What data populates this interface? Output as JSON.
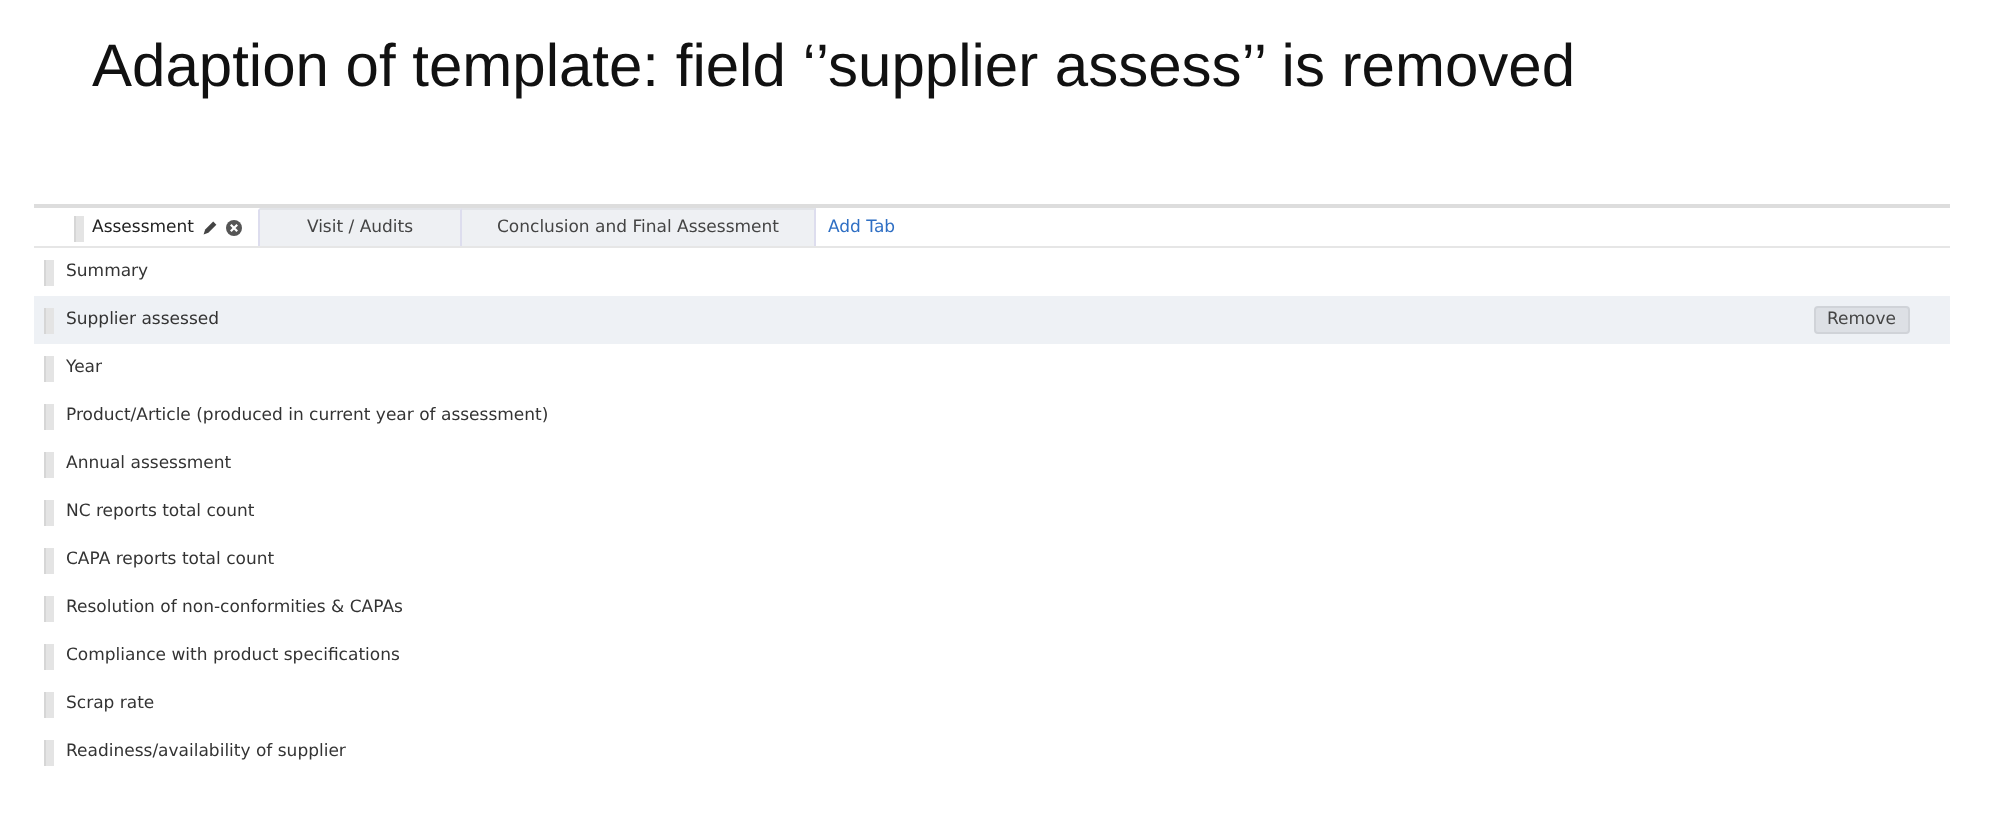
{
  "slide_title": "Adaption of template: field ‘’supplier assess’’ is removed",
  "tabs": [
    {
      "label": "Assessment",
      "kind": "tab",
      "selected": true
    },
    {
      "label": "Visit / Audits",
      "kind": "tab",
      "selected": false
    },
    {
      "label": "Conclusion and Final Assessment",
      "kind": "tab",
      "selected": false
    },
    {
      "label": "Add Tab",
      "kind": "link"
    }
  ],
  "fields": [
    {
      "label": "Summary",
      "hovered": false
    },
    {
      "label": "Supplier assessed",
      "hovered": true,
      "action": "Remove"
    },
    {
      "label": "Year",
      "hovered": false
    },
    {
      "label": "Product/Article (produced in current year of assessment)",
      "hovered": false
    },
    {
      "label": "Annual assessment",
      "hovered": false
    },
    {
      "label": "NC reports total count",
      "hovered": false
    },
    {
      "label": "CAPA reports total count",
      "hovered": false
    },
    {
      "label": "Resolution of non-conformities & CAPAs",
      "hovered": false
    },
    {
      "label": "Compliance with product specifications",
      "hovered": false
    },
    {
      "label": "Scrap rate",
      "hovered": false
    },
    {
      "label": "Readiness/availability of supplier",
      "hovered": false
    }
  ]
}
